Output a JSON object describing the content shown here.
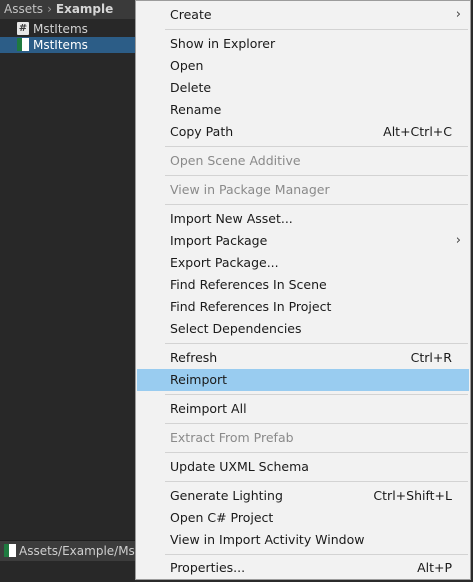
{
  "project": {
    "breadcrumb": [
      "Assets",
      "Example"
    ],
    "breadcrumb_separator": "›",
    "files": [
      {
        "name": "MstItems",
        "icon": "csharp-script-icon",
        "selected": false
      },
      {
        "name": "MstItems",
        "icon": "excel-file-icon",
        "selected": true
      }
    ],
    "status_path": "Assets/Example/MstItems.xlsx"
  },
  "menu": {
    "items": [
      {
        "label": "Create",
        "shortcut": "",
        "submenu": true,
        "disabled": false
      },
      {
        "label": "Show in Explorer",
        "shortcut": "",
        "submenu": false,
        "disabled": false
      },
      {
        "label": "Open",
        "shortcut": "",
        "submenu": false,
        "disabled": false
      },
      {
        "label": "Delete",
        "shortcut": "",
        "submenu": false,
        "disabled": false
      },
      {
        "label": "Rename",
        "shortcut": "",
        "submenu": false,
        "disabled": false
      },
      {
        "label": "Copy Path",
        "shortcut": "Alt+Ctrl+C",
        "submenu": false,
        "disabled": false
      },
      {
        "label": "Open Scene Additive",
        "shortcut": "",
        "submenu": false,
        "disabled": true
      },
      {
        "label": "View in Package Manager",
        "shortcut": "",
        "submenu": false,
        "disabled": true
      },
      {
        "label": "Import New Asset...",
        "shortcut": "",
        "submenu": false,
        "disabled": false
      },
      {
        "label": "Import Package",
        "shortcut": "",
        "submenu": true,
        "disabled": false
      },
      {
        "label": "Export Package...",
        "shortcut": "",
        "submenu": false,
        "disabled": false
      },
      {
        "label": "Find References In Scene",
        "shortcut": "",
        "submenu": false,
        "disabled": false
      },
      {
        "label": "Find References In Project",
        "shortcut": "",
        "submenu": false,
        "disabled": false
      },
      {
        "label": "Select Dependencies",
        "shortcut": "",
        "submenu": false,
        "disabled": false
      },
      {
        "label": "Refresh",
        "shortcut": "Ctrl+R",
        "submenu": false,
        "disabled": false
      },
      {
        "label": "Reimport",
        "shortcut": "",
        "submenu": false,
        "disabled": false,
        "highlighted": true
      },
      {
        "label": "Reimport All",
        "shortcut": "",
        "submenu": false,
        "disabled": false
      },
      {
        "label": "Extract From Prefab",
        "shortcut": "",
        "submenu": false,
        "disabled": true
      },
      {
        "label": "Update UXML Schema",
        "shortcut": "",
        "submenu": false,
        "disabled": false
      },
      {
        "label": "Generate Lighting",
        "shortcut": "Ctrl+Shift+L",
        "submenu": false,
        "disabled": false
      },
      {
        "label": "Open C# Project",
        "shortcut": "",
        "submenu": false,
        "disabled": false
      },
      {
        "label": "View in Import Activity Window",
        "shortcut": "",
        "submenu": false,
        "disabled": false
      },
      {
        "label": "Properties...",
        "shortcut": "Alt+P",
        "submenu": false,
        "disabled": false
      }
    ],
    "submenu_arrow": "›",
    "highlight_color": "#99ccf0"
  }
}
